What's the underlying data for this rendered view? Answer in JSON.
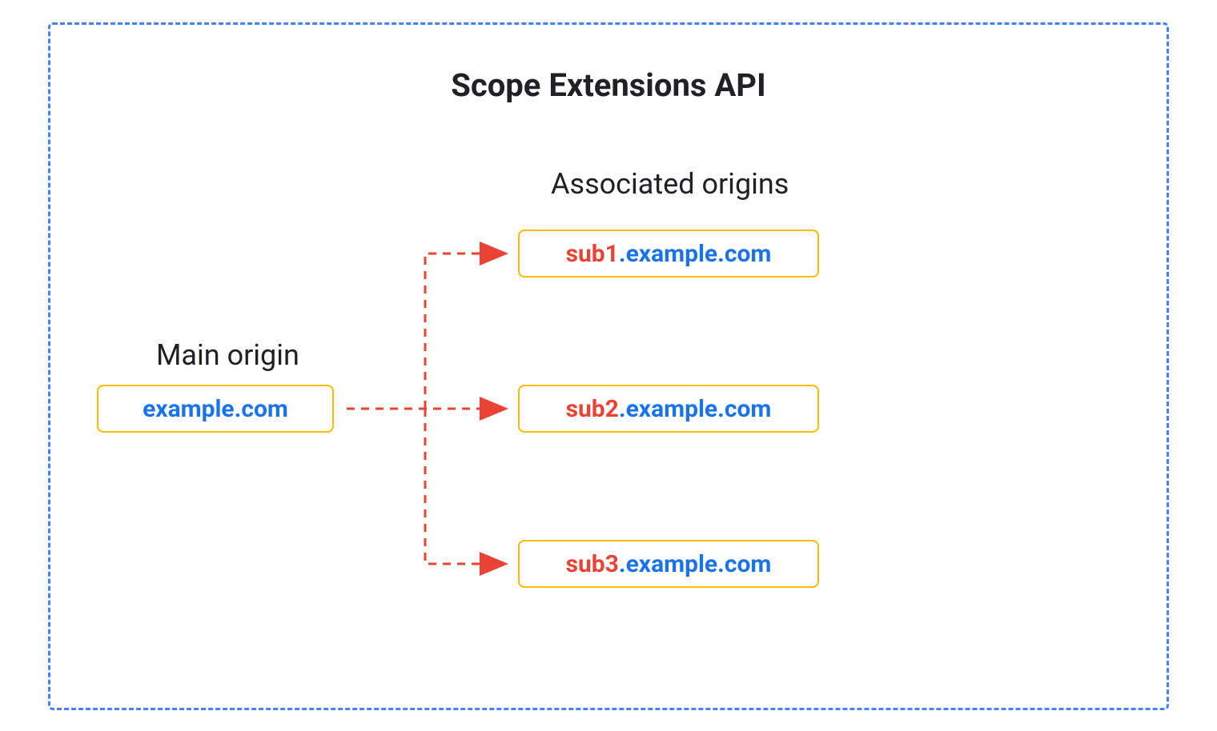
{
  "title": "Scope Extensions API",
  "main_origin_label": "Main origin",
  "main_origin_value": "example.com",
  "associated_label": "Associated origins",
  "associated": [
    {
      "sub": "sub1",
      "domain": ".example.com"
    },
    {
      "sub": "sub2",
      "domain": ".example.com"
    },
    {
      "sub": "sub3",
      "domain": ".example.com"
    }
  ],
  "colors": {
    "border_dash": "#4285f4",
    "box_border": "#fbbc04",
    "text_blue": "#1a73e8",
    "text_red": "#ea4335",
    "arrow": "#ea4335"
  }
}
